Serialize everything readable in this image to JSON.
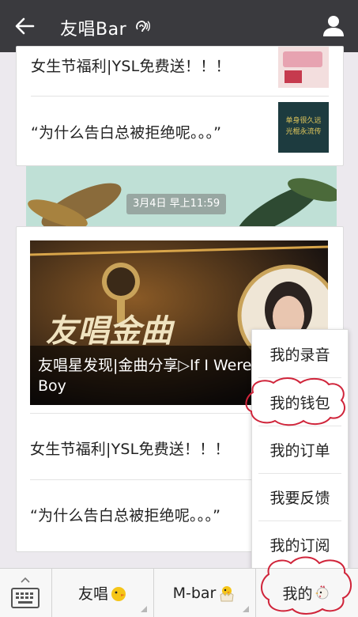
{
  "header": {
    "title": "友唱Bar"
  },
  "top_card": {
    "row1_text": "女生节福利|YSL免费送！！！",
    "row2_text": "“为什么告白总被拒绝呢。。。”",
    "thumb2_text": "单身很久远 光棍永流传"
  },
  "timestamp": "3月4日 早上11:59",
  "article": {
    "banner_title": "友唱金曲",
    "banner_caption_line1": "友唱星发现|金曲分享▷If I Were",
    "banner_caption_line2": "Boy",
    "row1_text": "女生节福利|YSL免费送！！！",
    "row2_text": "“为什么告白总被拒绝呢。。。”"
  },
  "popup_menu": {
    "items": [
      "我的录音",
      "我的钱包",
      "我的订单",
      "我要反馈",
      "我的订阅"
    ]
  },
  "bottom_bar": {
    "tab1": "友唱",
    "tab2": "M-bar",
    "tab3": "我的"
  },
  "colors": {
    "topbar": "#3a3a3e",
    "annotation": "#d0243a"
  }
}
